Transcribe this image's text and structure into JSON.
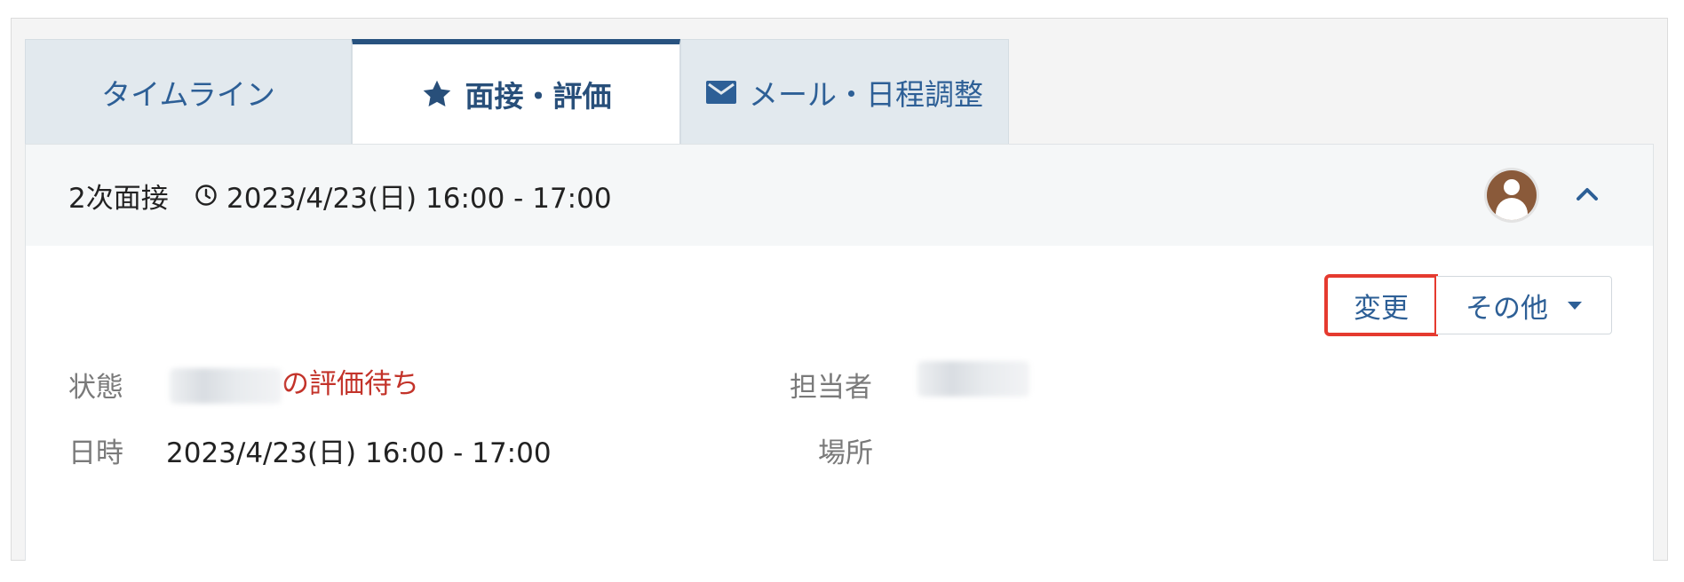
{
  "tabs": [
    {
      "label": "タイムライン",
      "icon": "",
      "active": false
    },
    {
      "label": "面接・評価",
      "icon": "star-icon",
      "active": true
    },
    {
      "label": "メール・日程調整",
      "icon": "mail-icon",
      "active": false
    }
  ],
  "interview": {
    "stage": "2次面接",
    "datetime": "2023/4/23(日) 16:00 - 17:00"
  },
  "actions": {
    "change_label": "変更",
    "other_label": "その他"
  },
  "details": {
    "status_label": "状態",
    "status_value": "の評価待ち",
    "datetime_label": "日時",
    "datetime_value": "2023/4/23(日) 16:00 - 17:00",
    "assignee_label": "担当者",
    "place_label": "場所"
  },
  "colors": {
    "accent": "#2d5f96",
    "status_red": "#c3332a",
    "highlight": "#e53a2f"
  }
}
